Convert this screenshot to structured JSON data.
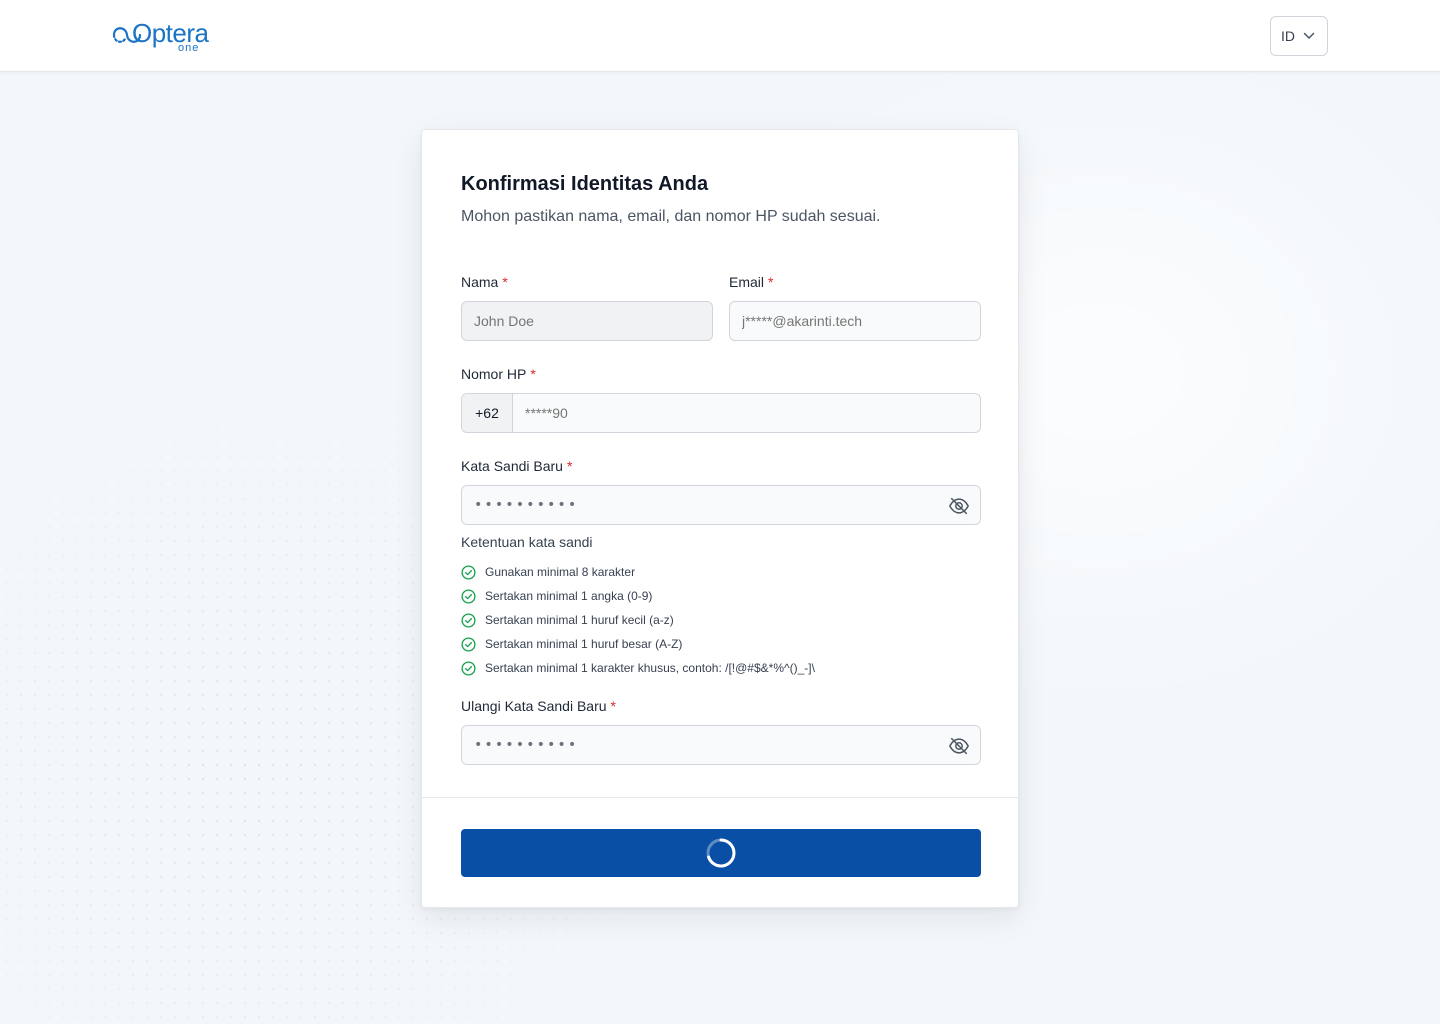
{
  "header": {
    "logo_text": "Optera",
    "logo_sub": "one",
    "language": "ID"
  },
  "form": {
    "title": "Konfirmasi Identitas Anda",
    "subtitle": "Mohon pastikan nama, email, dan nomor HP sudah sesuai.",
    "required_mark": "*",
    "name": {
      "label": "Nama",
      "placeholder": "John Doe"
    },
    "email": {
      "label": "Email",
      "placeholder": "j*****@akarinti.tech"
    },
    "phone": {
      "label": "Nomor HP",
      "prefix": "+62",
      "placeholder": "*****90"
    },
    "password": {
      "label": "Kata Sandi Baru",
      "value": "••••••••••"
    },
    "rules_title": "Ketentuan kata sandi",
    "rules": [
      "Gunakan minimal 8 karakter",
      "Sertakan minimal 1 angka (0-9)",
      "Sertakan minimal 1 huruf kecil (a-z)",
      "Sertakan minimal 1 huruf besar (A-Z)",
      "Sertakan minimal 1 karakter khusus, contoh: /[!@#$&*%^()_-]\\"
    ],
    "confirm_password": {
      "label": "Ulangi Kata Sandi Baru",
      "value": "••••••••••"
    }
  },
  "colors": {
    "brand": "#1b74c4",
    "primary_button": "#0a4fa6",
    "success": "#16a34a",
    "required": "#dc2626"
  },
  "icons": {
    "password_toggle": "eye-off-icon",
    "rule_status": "check-circle-icon",
    "language_dropdown": "chevron-down-icon",
    "submit_state": "loading-spinner-icon"
  }
}
